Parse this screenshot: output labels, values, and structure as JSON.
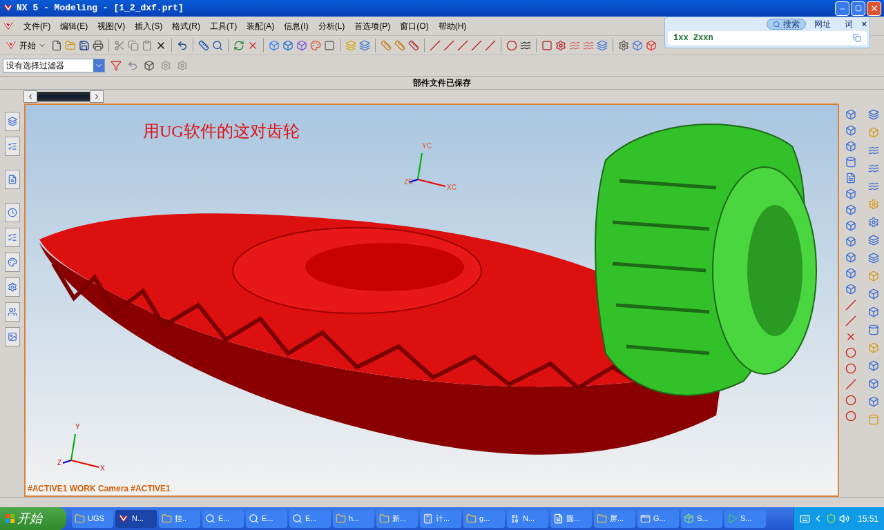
{
  "window": {
    "title": "NX 5 - Modeling - [1_2_dxf.prt]"
  },
  "menu": [
    "文件(F)",
    "编辑(E)",
    "视图(V)",
    "插入(S)",
    "格式(R)",
    "工具(T)",
    "装配(A)",
    "信息(I)",
    "分析(L)",
    "首选项(P)",
    "窗口(O)",
    "帮助(H)"
  ],
  "toolbar": {
    "start_label": "开始"
  },
  "filter": {
    "value": "没有选择过滤器"
  },
  "status": {
    "message": "部件文件已保存"
  },
  "search_widget": {
    "tabs": [
      {
        "label": "搜索",
        "selected": true
      },
      {
        "label": "网址",
        "selected": false
      },
      {
        "label": "词",
        "selected": false
      }
    ],
    "close": "×",
    "value": "1xx 2xxn"
  },
  "viewport": {
    "caption": "用UG软件的这对齿轮",
    "view_label": "#ACTIVE1 WORK Camera #ACTIVE1",
    "work_axes": [
      "XC",
      "YC",
      "ZC"
    ],
    "absolute_axes": [
      "X",
      "Y",
      "Z"
    ]
  },
  "taskbar": {
    "start": "开始",
    "clock": "15:51",
    "items": [
      {
        "label": "UGS",
        "kind": "folder",
        "selected": false
      },
      {
        "label": "N...",
        "kind": "nx",
        "selected": true
      },
      {
        "label": "挂..",
        "kind": "folder",
        "selected": false
      },
      {
        "label": "E...",
        "kind": "search",
        "selected": false
      },
      {
        "label": "E...",
        "kind": "search",
        "selected": false
      },
      {
        "label": "E...",
        "kind": "search",
        "selected": false
      },
      {
        "label": "h...",
        "kind": "folder",
        "selected": false
      },
      {
        "label": "新...",
        "kind": "folder",
        "selected": false
      },
      {
        "label": "计...",
        "kind": "calc",
        "selected": false
      },
      {
        "label": "g...",
        "kind": "folder",
        "selected": false
      },
      {
        "label": "N...",
        "kind": "binary",
        "selected": false
      },
      {
        "label": "圆...",
        "kind": "word",
        "selected": false
      },
      {
        "label": "屏...",
        "kind": "folder",
        "selected": false
      },
      {
        "label": "G...",
        "kind": "app",
        "selected": false
      },
      {
        "label": "S...",
        "kind": "box",
        "selected": false
      },
      {
        "label": "S...",
        "kind": "play",
        "selected": false
      }
    ]
  }
}
